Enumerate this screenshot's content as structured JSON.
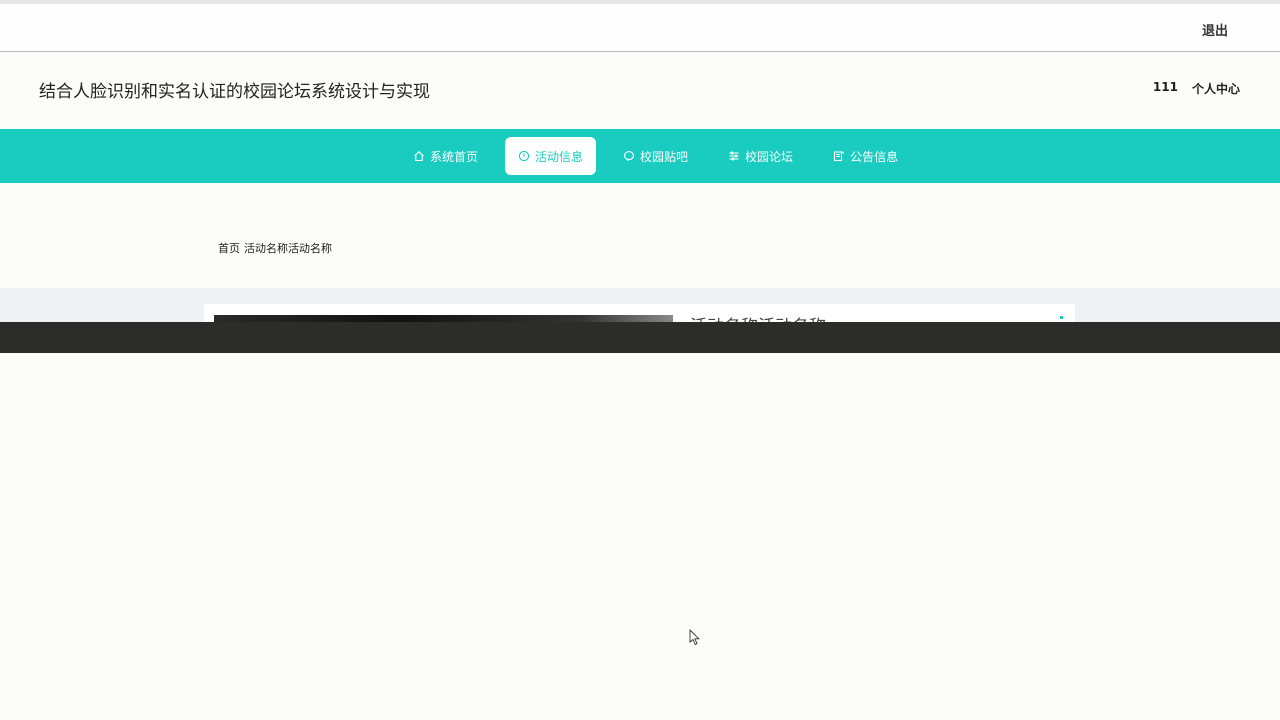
{
  "topbar": {
    "logout_label": "退出"
  },
  "header": {
    "site_title": "结合人脸识别和实名认证的校园论坛系统设计与实现",
    "username": "111",
    "profile_label": "个人中心"
  },
  "nav": {
    "items": [
      {
        "label": "系统首页",
        "icon": "home-icon",
        "active": false
      },
      {
        "label": "活动信息",
        "icon": "clock-icon",
        "active": true
      },
      {
        "label": "校园贴吧",
        "icon": "chat-icon",
        "active": false
      },
      {
        "label": "校园论坛",
        "icon": "sliders-icon",
        "active": false
      },
      {
        "label": "公告信息",
        "icon": "notice-icon",
        "active": false
      }
    ]
  },
  "breadcrumb": {
    "home": "首页",
    "current": "活动名称活动名称"
  },
  "detail": {
    "title": "活动名称活动名称"
  },
  "colors": {
    "accent": "#1accc0",
    "dark_band": "#2c2d2b"
  }
}
